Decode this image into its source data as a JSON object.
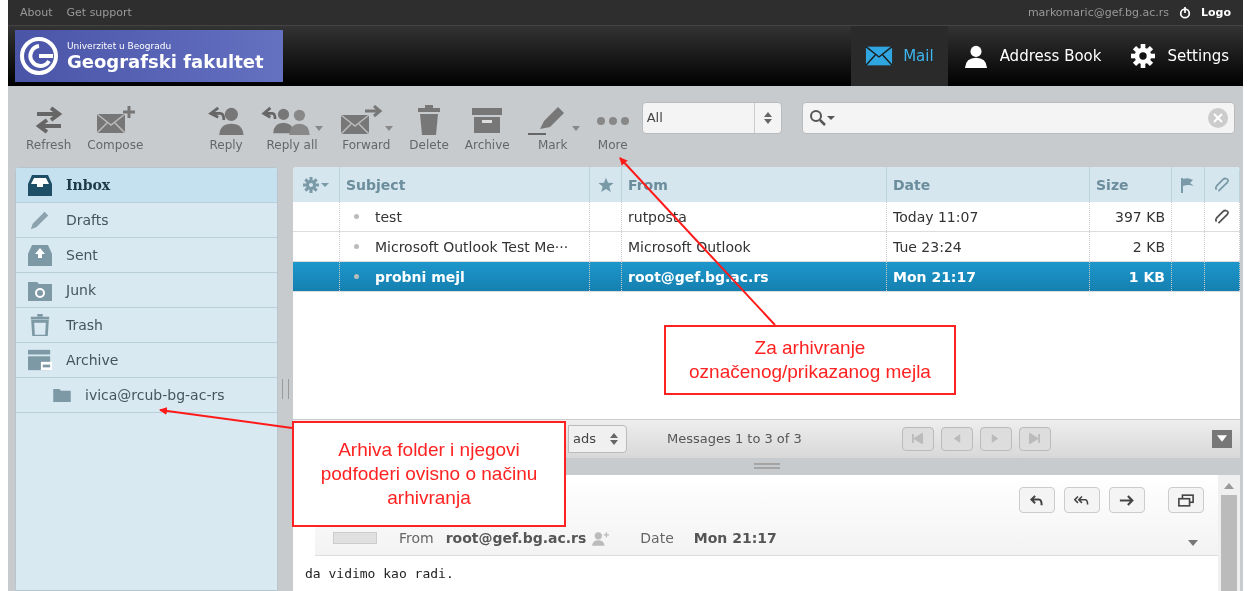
{
  "top_links": [
    "About",
    "Get support"
  ],
  "user": {
    "email": "markomaric@gef.bg.ac.rs",
    "logout": "Logo"
  },
  "logo": {
    "university": "Univerzitet u Beogradu",
    "faculty": "Geografski fakultet"
  },
  "nav": [
    {
      "label": "Mail",
      "kind": "mail",
      "selected": true
    },
    {
      "label": "Address Book",
      "kind": "contacts",
      "selected": false
    },
    {
      "label": "Settings",
      "kind": "settings",
      "selected": false
    }
  ],
  "toolbar": [
    {
      "label": "Refresh",
      "kind": "refresh",
      "dropdown": false
    },
    {
      "label": "Compose",
      "kind": "compose",
      "dropdown": false
    },
    {
      "label": "Reply",
      "kind": "reply",
      "dropdown": false
    },
    {
      "label": "Reply all",
      "kind": "replyall",
      "dropdown": true
    },
    {
      "label": "Forward",
      "kind": "forward",
      "dropdown": true
    },
    {
      "label": "Delete",
      "kind": "delete",
      "dropdown": false
    },
    {
      "label": "Archive",
      "kind": "archive",
      "dropdown": false
    },
    {
      "label": "Mark",
      "kind": "mark",
      "dropdown": true
    },
    {
      "label": "More",
      "kind": "more",
      "dropdown": false
    }
  ],
  "filter": {
    "value": "All"
  },
  "folders": [
    {
      "label": "Inbox",
      "kind": "inbox",
      "selected": true
    },
    {
      "label": "Drafts",
      "kind": "drafts",
      "selected": false
    },
    {
      "label": "Sent",
      "kind": "sent",
      "selected": false
    },
    {
      "label": "Junk",
      "kind": "junk",
      "selected": false
    },
    {
      "label": "Trash",
      "kind": "trash",
      "selected": false
    },
    {
      "label": "Archive",
      "kind": "archive",
      "selected": false,
      "children": [
        {
          "label": "ivica@rcub-bg-ac-rs",
          "kind": "folder",
          "selected": false
        }
      ]
    }
  ],
  "message_list": {
    "columns": {
      "subject": "Subject",
      "from": "From",
      "date": "Date",
      "size": "Size"
    },
    "rows": [
      {
        "subject": "test",
        "from": "rutposta",
        "date": "Today 11:07",
        "size": "397 KB",
        "attachment": true,
        "selected": false
      },
      {
        "subject": "Microsoft Outlook Test Me···",
        "from": "Microsoft Outlook",
        "date": "Tue 23:24",
        "size": "2 KB",
        "attachment": false,
        "selected": false
      },
      {
        "subject": "probni mejl",
        "from": "root@gef.bg.ac.rs",
        "date": "Mon 21:17",
        "size": "1 KB",
        "attachment": false,
        "selected": true
      }
    ]
  },
  "list_footer": {
    "threads": "ads",
    "count": "Messages 1 to 3 of 3"
  },
  "preview": {
    "from_label": "From",
    "from": "root@gef.bg.ac.rs",
    "date_label": "Date",
    "date": "Mon 21:17",
    "body": "da vidimo kao radi."
  },
  "callouts": [
    {
      "text": "Za arhivranje\noznačenog/prikazanog mejla",
      "kind": "archive-button"
    },
    {
      "text": "Arhiva folder i njegovi\npodfoderi ovisno o načinu\narhivranja",
      "kind": "archive-folder"
    }
  ]
}
